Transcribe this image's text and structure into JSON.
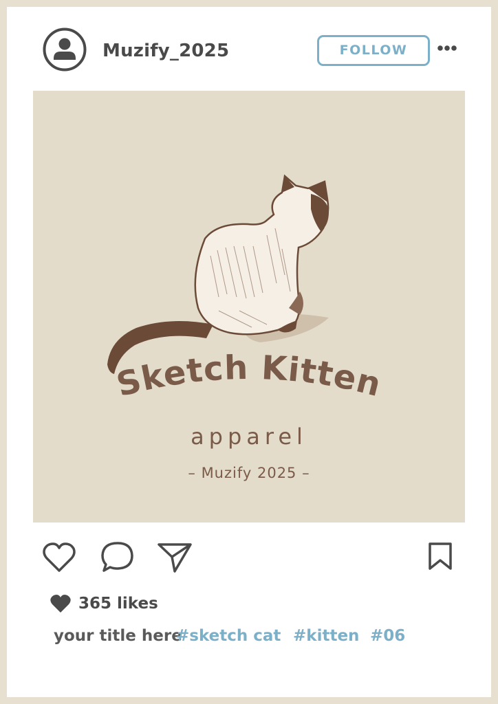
{
  "post": {
    "username": "Muzify_2025",
    "follow_label": "FOLLOW",
    "image": {
      "brand_title": "Sketch Kitten",
      "brand_subtitle": "apparel",
      "brand_tag": "– Muzify 2025 –"
    },
    "likes": "365 likes",
    "caption_title": "your title here",
    "hashtags": [
      "#sketch cat",
      "#kitten",
      "#06"
    ]
  },
  "colors": {
    "background": "#e7dfd0",
    "card": "#ffffff",
    "image_bg": "#e3dcca",
    "accent": "#7bb0c8",
    "text": "#4a4a4a",
    "brand_brown": "#7a5a48"
  },
  "icons": {
    "avatar": "user-avatar-icon",
    "more": "more-dots-icon",
    "like": "heart-outline-icon",
    "comment": "comment-bubble-icon",
    "share": "paper-plane-icon",
    "bookmark": "bookmark-icon",
    "likes": "heart-filled-icon"
  }
}
